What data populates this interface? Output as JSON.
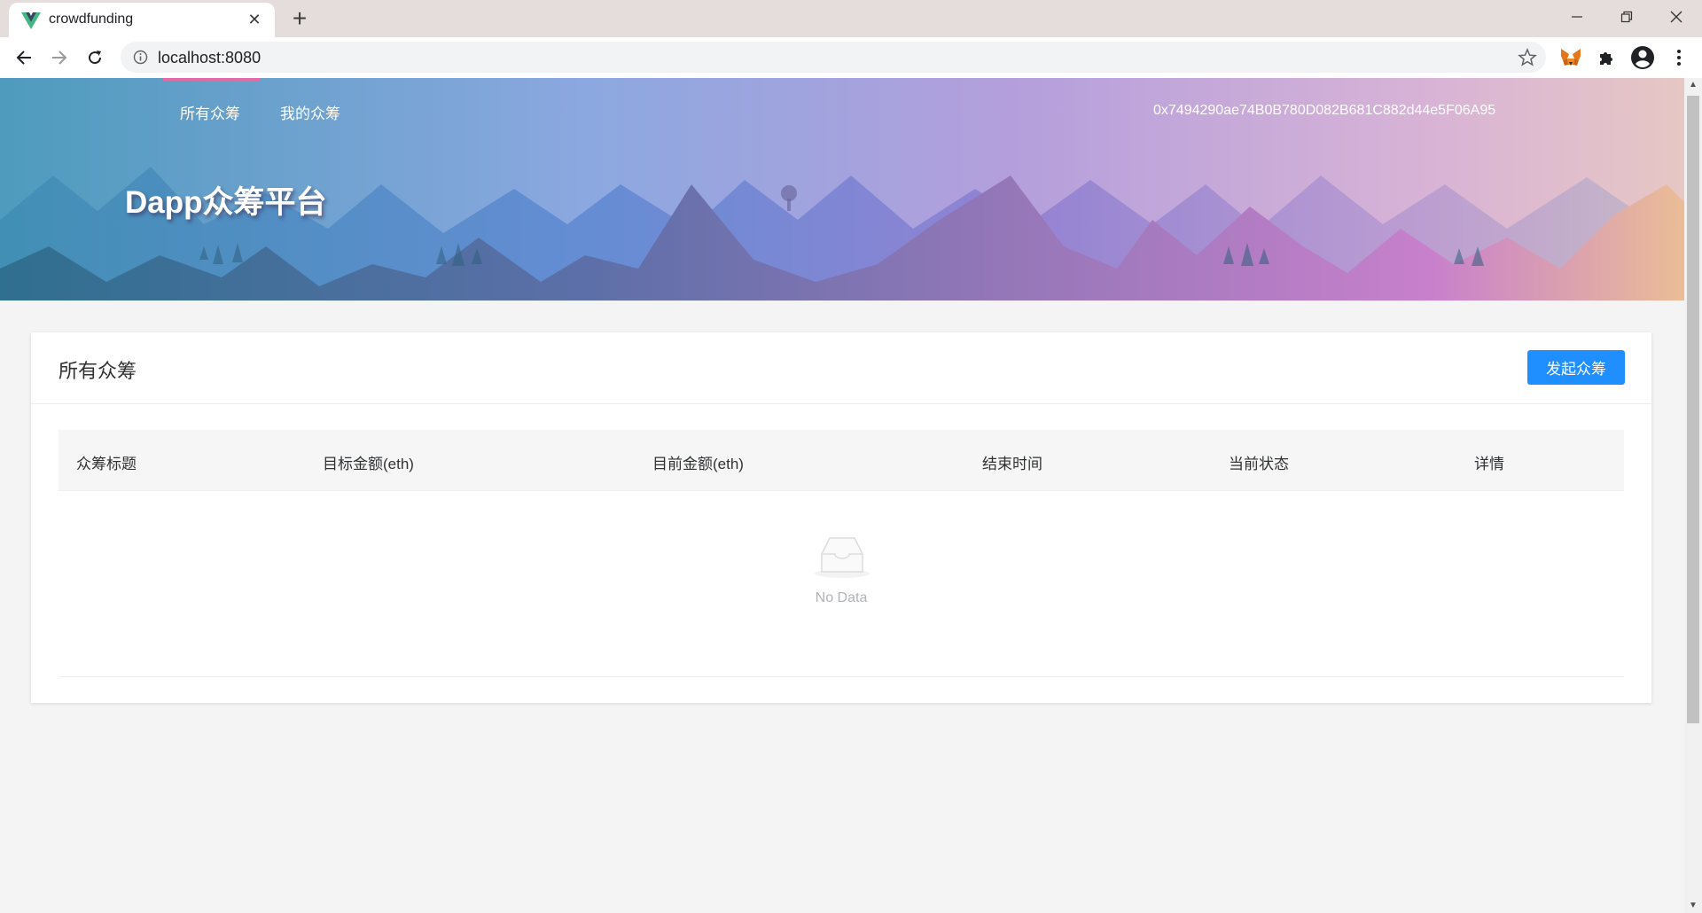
{
  "browser": {
    "tab_title": "crowdfunding",
    "new_tab_label": "+",
    "url": "localhost:8080"
  },
  "nav": {
    "items": [
      {
        "label": "所有众筹"
      },
      {
        "label": "我的众筹"
      }
    ],
    "account": "0x7494290ae74B0B780D082B681C882d44e5F06A95",
    "brand": "Dapp众筹平台",
    "active_color": "#e36aa3"
  },
  "card": {
    "title": "所有众筹",
    "create_button": "发起众筹"
  },
  "table": {
    "columns": [
      "众筹标题",
      "目标金额(eth)",
      "目前金额(eth)",
      "结束时间",
      "当前状态",
      "详情"
    ],
    "empty_text": "No Data"
  },
  "colors": {
    "primary": "#1f8fff",
    "page_bg": "#f4f4f4"
  },
  "icons": {
    "favicon": "vue-logo-icon",
    "empty": "inbox-icon",
    "extension_fox": "metamask-fox-icon",
    "extensions": "puzzle-icon",
    "profile": "account-circle-icon"
  }
}
